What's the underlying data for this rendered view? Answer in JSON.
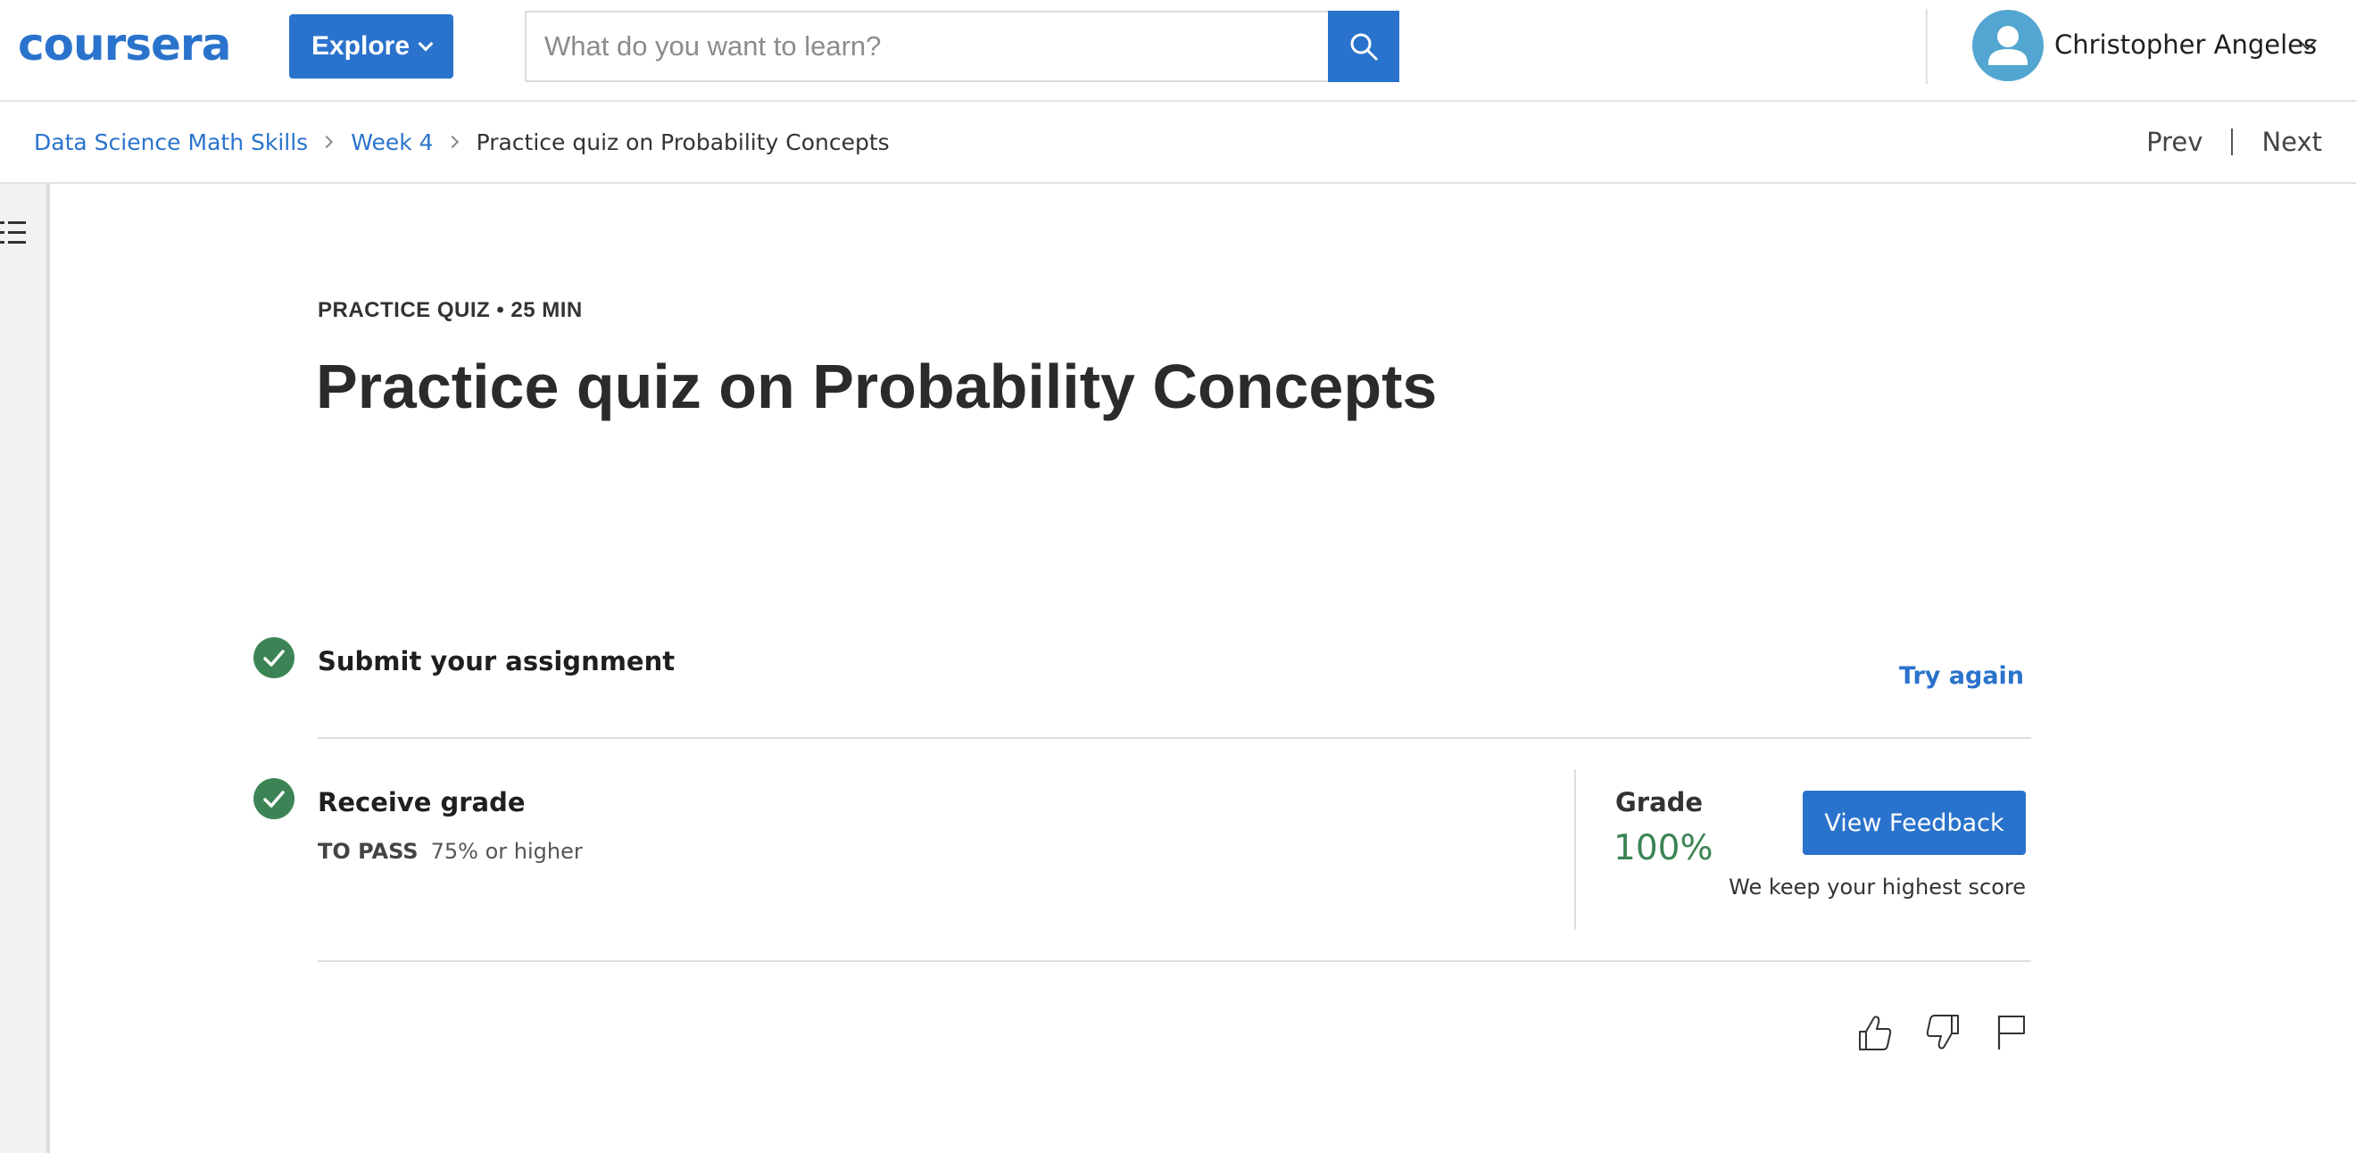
{
  "header": {
    "logo_text": "coursera",
    "explore_label": "Explore",
    "search": {
      "placeholder": "What do you want to learn?",
      "value": ""
    },
    "user": {
      "name": "Christopher Angeles"
    }
  },
  "breadcrumb": {
    "items": [
      "Data Science Math Skills",
      "Week 4"
    ],
    "current": "Practice quiz on Probability Concepts"
  },
  "nav": {
    "prev": "Prev",
    "next": "Next"
  },
  "quiz": {
    "meta": "PRACTICE QUIZ • 25 MIN",
    "title": "Practice quiz on Probability Concepts"
  },
  "steps": {
    "submit": {
      "title": "Submit your assignment",
      "action": "Try again"
    },
    "grade": {
      "title": "Receive grade",
      "pass_label": "TO PASS",
      "pass_value": "75% or higher",
      "grade_label": "Grade",
      "grade_value": "100%",
      "feedback_button": "View Feedback",
      "note": "We keep your highest score"
    }
  },
  "colors": {
    "brand_blue": "#2a73cc",
    "success_green": "#3c8455",
    "avatar_blue": "#53a6d1"
  },
  "icons": [
    "search-icon",
    "user-avatar-icon",
    "menu-list-icon",
    "check-icon",
    "thumbs-up-icon",
    "thumbs-down-icon",
    "flag-icon"
  ]
}
